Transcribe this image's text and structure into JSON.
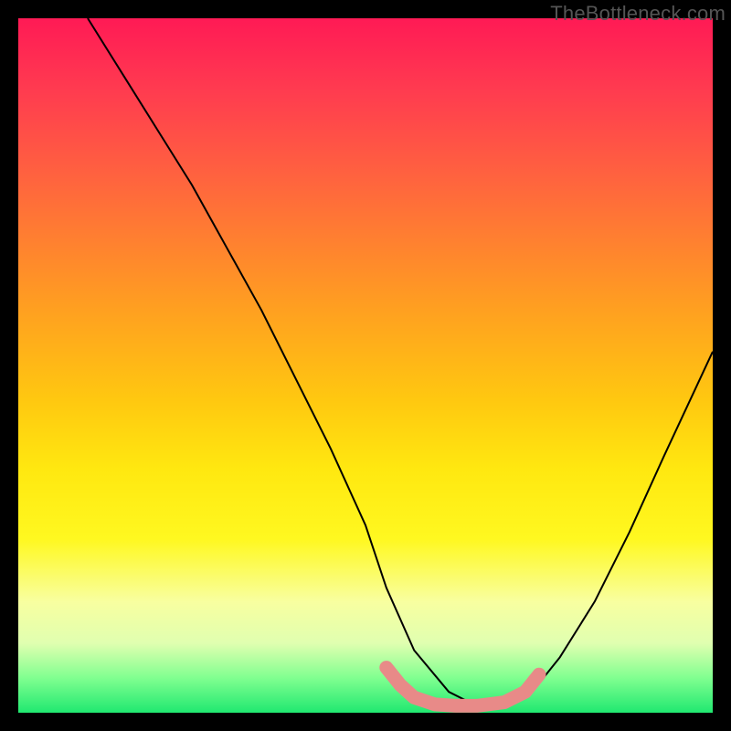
{
  "watermark": "TheBottleneck.com",
  "chart_data": {
    "type": "line",
    "title": "",
    "xlabel": "",
    "ylabel": "",
    "xlim": [
      0,
      100
    ],
    "ylim": [
      0,
      100
    ],
    "series": [
      {
        "name": "curve",
        "x": [
          10,
          15,
          20,
          25,
          30,
          35,
          40,
          45,
          50,
          53,
          57,
          62,
          66,
          70,
          74,
          78,
          83,
          88,
          93,
          100
        ],
        "y": [
          100,
          92,
          84,
          76,
          67,
          58,
          48,
          38,
          27,
          18,
          9,
          3,
          1,
          1,
          3,
          8,
          16,
          26,
          37,
          52
        ]
      },
      {
        "name": "highlight",
        "x": [
          53,
          55,
          57,
          60,
          63,
          66,
          70,
          73,
          75
        ],
        "y": [
          6.5,
          4.0,
          2.2,
          1.2,
          1.0,
          1.0,
          1.5,
          3.0,
          5.5
        ]
      }
    ],
    "colors": {
      "curve": "#000000",
      "highlight": "#e88a88"
    }
  }
}
